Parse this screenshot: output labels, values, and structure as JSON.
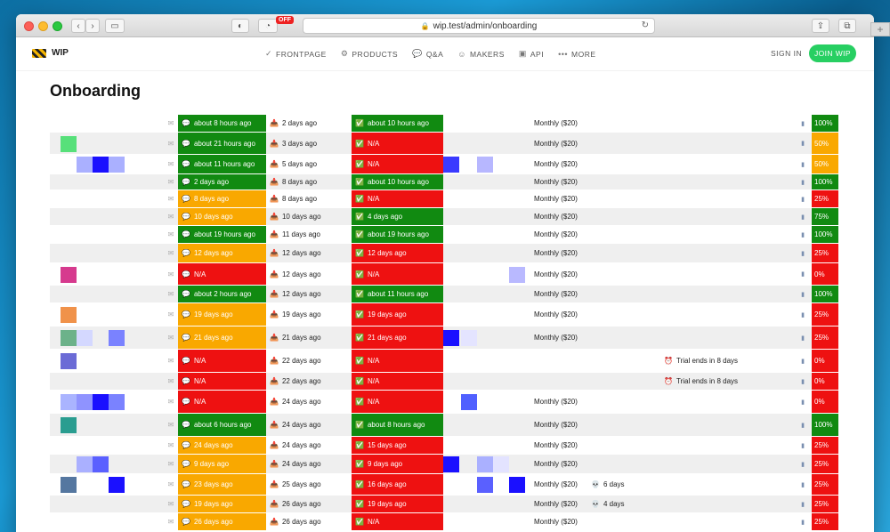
{
  "browser": {
    "url": "wip.test/admin/onboarding",
    "extension_badge": "OFF"
  },
  "nav": {
    "brand": "WIP",
    "items": [
      {
        "label": "FRONTPAGE",
        "icon": "check-circle-icon"
      },
      {
        "label": "PRODUCTS",
        "icon": "products-icon"
      },
      {
        "label": "Q&A",
        "icon": "chat-bubbles-icon"
      },
      {
        "label": "MAKERS",
        "icon": "smile-icon"
      },
      {
        "label": "API",
        "icon": "api-icon"
      },
      {
        "label": "MORE",
        "icon": "dots-icon"
      }
    ],
    "sign_in": "SIGN IN",
    "join": "JOIN WIP"
  },
  "page_title": "Onboarding",
  "colors": {
    "green": "#118a11",
    "orange": "#f9a800",
    "red": "#ee1111",
    "join_button": "#27cf62"
  },
  "rows": [
    {
      "msg": "about 8 hours ago",
      "msg_status": "g",
      "inbox": "2 days ago",
      "check": "about 10 hours ago",
      "check_status": "g",
      "plan": "Monthly ($20)",
      "extra": "",
      "trial": "",
      "pct": "100%",
      "pct_status": "g"
    },
    {
      "msg": "about 21 hours ago",
      "msg_status": "g",
      "inbox": "3 days ago",
      "check": "N/A",
      "check_status": "r",
      "plan": "Monthly ($20)",
      "extra": "",
      "trial": "",
      "pct": "50%",
      "pct_status": "o"
    },
    {
      "msg": "about 11 hours ago",
      "msg_status": "g",
      "inbox": "5 days ago",
      "check": "N/A",
      "check_status": "r",
      "plan": "Monthly ($20)",
      "extra": "",
      "trial": "",
      "pct": "50%",
      "pct_status": "o"
    },
    {
      "msg": "2 days ago",
      "msg_status": "g",
      "inbox": "8 days ago",
      "check": "about 10 hours ago",
      "check_status": "g",
      "plan": "Monthly ($20)",
      "extra": "",
      "trial": "",
      "pct": "100%",
      "pct_status": "g"
    },
    {
      "msg": "8 days ago",
      "msg_status": "o",
      "inbox": "8 days ago",
      "check": "N/A",
      "check_status": "r",
      "plan": "Monthly ($20)",
      "extra": "",
      "trial": "",
      "pct": "25%",
      "pct_status": "r"
    },
    {
      "msg": "10 days ago",
      "msg_status": "o",
      "inbox": "10 days ago",
      "check": "4 days ago",
      "check_status": "g",
      "plan": "Monthly ($20)",
      "extra": "",
      "trial": "",
      "pct": "75%",
      "pct_status": "g"
    },
    {
      "msg": "about 19 hours ago",
      "msg_status": "g",
      "inbox": "11 days ago",
      "check": "about 19 hours ago",
      "check_status": "g",
      "plan": "Monthly ($20)",
      "extra": "",
      "trial": "",
      "pct": "100%",
      "pct_status": "g"
    },
    {
      "msg": "12 days ago",
      "msg_status": "o",
      "inbox": "12 days ago",
      "check": "12 days ago",
      "check_status": "r",
      "plan": "Monthly ($20)",
      "extra": "",
      "trial": "",
      "pct": "25%",
      "pct_status": "r"
    },
    {
      "msg": "N/A",
      "msg_status": "r",
      "inbox": "12 days ago",
      "check": "N/A",
      "check_status": "r",
      "plan": "Monthly ($20)",
      "extra": "",
      "trial": "",
      "pct": "0%",
      "pct_status": "r"
    },
    {
      "msg": "about 2 hours ago",
      "msg_status": "g",
      "inbox": "12 days ago",
      "check": "about 11 hours ago",
      "check_status": "g",
      "plan": "Monthly ($20)",
      "extra": "",
      "trial": "",
      "pct": "100%",
      "pct_status": "g"
    },
    {
      "msg": "19 days ago",
      "msg_status": "o",
      "inbox": "19 days ago",
      "check": "19 days ago",
      "check_status": "r",
      "plan": "Monthly ($20)",
      "extra": "",
      "trial": "",
      "pct": "25%",
      "pct_status": "r"
    },
    {
      "msg": "21 days ago",
      "msg_status": "o",
      "inbox": "21 days ago",
      "check": "21 days ago",
      "check_status": "r",
      "plan": "Monthly ($20)",
      "extra": "",
      "trial": "",
      "pct": "25%",
      "pct_status": "r"
    },
    {
      "msg": "N/A",
      "msg_status": "r",
      "inbox": "22 days ago",
      "check": "N/A",
      "check_status": "r",
      "plan": "",
      "extra": "",
      "trial": "Trial ends in 8 days",
      "pct": "0%",
      "pct_status": "r"
    },
    {
      "msg": "N/A",
      "msg_status": "r",
      "inbox": "22 days ago",
      "check": "N/A",
      "check_status": "r",
      "plan": "",
      "extra": "",
      "trial": "Trial ends in 8 days",
      "pct": "0%",
      "pct_status": "r"
    },
    {
      "msg": "N/A",
      "msg_status": "r",
      "inbox": "24 days ago",
      "check": "N/A",
      "check_status": "r",
      "plan": "Monthly ($20)",
      "extra": "",
      "trial": "",
      "pct": "0%",
      "pct_status": "r"
    },
    {
      "msg": "about 6 hours ago",
      "msg_status": "g",
      "inbox": "24 days ago",
      "check": "about 8 hours ago",
      "check_status": "g",
      "plan": "Monthly ($20)",
      "extra": "",
      "trial": "",
      "pct": "100%",
      "pct_status": "g"
    },
    {
      "msg": "24 days ago",
      "msg_status": "o",
      "inbox": "24 days ago",
      "check": "15 days ago",
      "check_status": "r",
      "plan": "Monthly ($20)",
      "extra": "",
      "trial": "",
      "pct": "25%",
      "pct_status": "r"
    },
    {
      "msg": "9 days ago",
      "msg_status": "o",
      "inbox": "24 days ago",
      "check": "9 days ago",
      "check_status": "r",
      "plan": "Monthly ($20)",
      "extra": "",
      "trial": "",
      "pct": "25%",
      "pct_status": "r"
    },
    {
      "msg": "23 days ago",
      "msg_status": "o",
      "inbox": "25 days ago",
      "check": "16 days ago",
      "check_status": "r",
      "plan": "Monthly ($20)",
      "extra": "6 days",
      "trial": "",
      "pct": "25%",
      "pct_status": "r"
    },
    {
      "msg": "19 days ago",
      "msg_status": "o",
      "inbox": "26 days ago",
      "check": "19 days ago",
      "check_status": "r",
      "plan": "Monthly ($20)",
      "extra": "4 days",
      "trial": "",
      "pct": "25%",
      "pct_status": "r"
    },
    {
      "msg": "26 days ago",
      "msg_status": "o",
      "inbox": "26 days ago",
      "check": "N/A",
      "check_status": "r",
      "plan": "Monthly ($20)",
      "extra": "",
      "trial": "",
      "pct": "25%",
      "pct_status": "r"
    }
  ]
}
